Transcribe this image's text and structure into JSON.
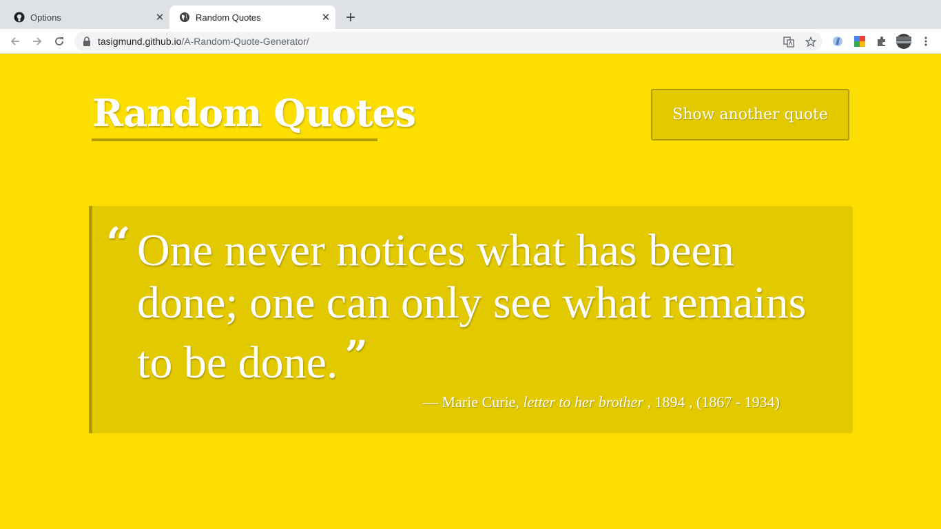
{
  "browser": {
    "tabs": [
      {
        "title": "Options",
        "favicon": "github-icon",
        "active": false
      },
      {
        "title": "Random Quotes",
        "favicon": "globe-icon",
        "active": true
      }
    ],
    "url_host": "tasigmund.github.io",
    "url_path": "/A-Random-Quote-Generator/"
  },
  "page": {
    "title": "Random Quotes",
    "button_label": "Show another quote",
    "quote": {
      "open_mark": "“",
      "text": "One never notices what has been done; one can only see what remains to be done.",
      "close_mark": "”",
      "dash": "— ",
      "author": "Marie Curie,",
      "citation": "letter to her brother",
      "year": " , 1894 , ",
      "lifespan": "(1867 - 1934)"
    }
  },
  "colors": {
    "background": "#fcdf00",
    "panel": "#e3c900",
    "accent_border": "#b09a0c",
    "text": "#ffffff"
  }
}
